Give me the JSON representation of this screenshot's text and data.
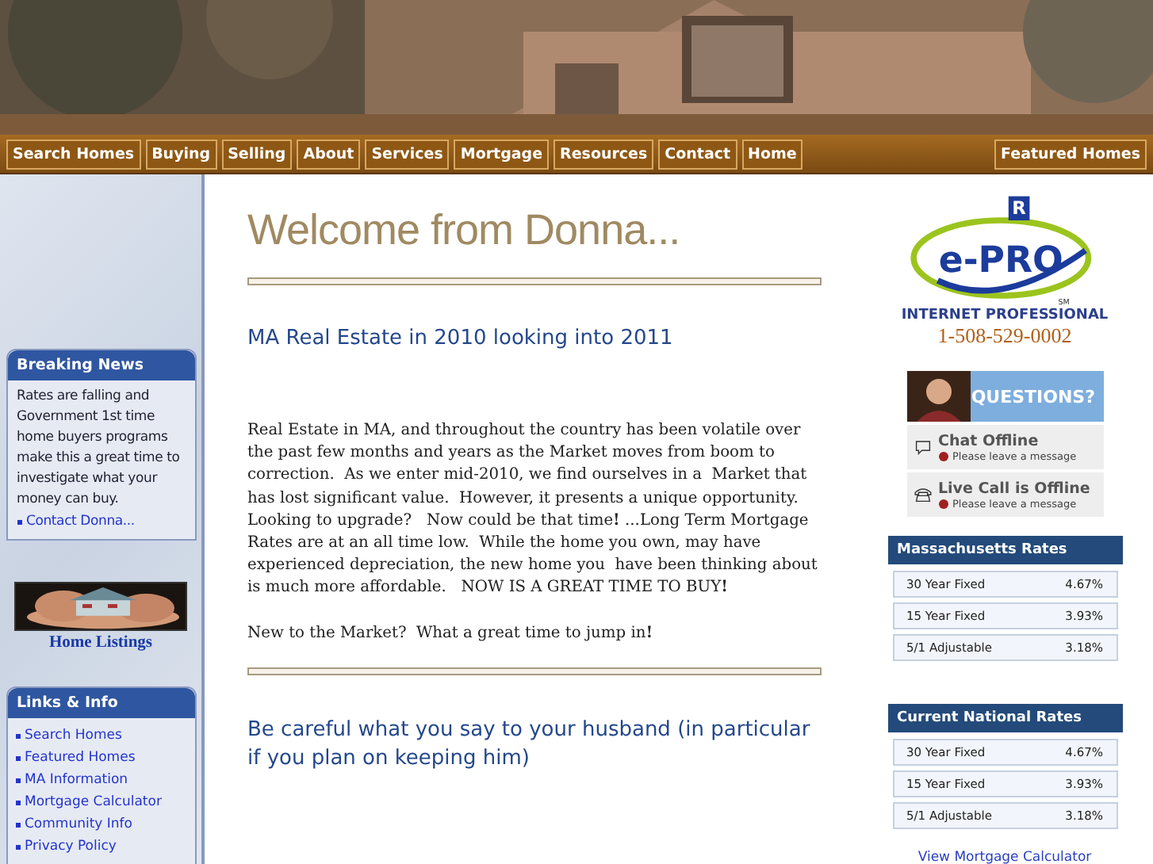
{
  "nav": {
    "items": [
      {
        "label": "Search Homes"
      },
      {
        "label": "Buying"
      },
      {
        "label": "Selling"
      },
      {
        "label": "About"
      },
      {
        "label": "Services"
      },
      {
        "label": "Mortgage"
      },
      {
        "label": "Resources"
      },
      {
        "label": "Contact"
      },
      {
        "label": "Home"
      }
    ],
    "right_item": {
      "label": "Featured Homes"
    }
  },
  "sidebar": {
    "breaking_news": {
      "title": "Breaking News",
      "text": "Rates are falling and Government 1st time home buyers programs make this a great time to investigate what your money can buy.",
      "link": "Contact Donna..."
    },
    "home_listings": {
      "caption": "Home Listings"
    },
    "links": {
      "title": "Links & Info",
      "items": [
        "Search Homes",
        "Featured Homes",
        "MA Information",
        "Mortgage Calculator",
        "Community Info",
        "Privacy Policy"
      ]
    }
  },
  "main": {
    "title": "Welcome from Donna...",
    "heading": "MA Real Estate in 2010 looking into 2011",
    "paragraphs": [
      "Real Estate in MA, and throughout the country has been volatile over the past few months and years as the Market moves from boom to correction.  As we enter mid-2010, we find ourselves in a  Market that has lost significant value.  However, it presents a unique opportunity.  Looking to upgrade?   Now could be that time**!** ...Long Term Mortgage Rates are at an all time low.  While the home you own, may have experienced depreciation, the new home you  have been thinking about is much more affordable.   NOW IS A GREAT TIME TO BUY**!**",
      "New to the Market?  What a great time to jump in**!**"
    ],
    "heading2": "Be careful what you say to your husband (in particular if you plan on keeping him)"
  },
  "right": {
    "logo": {
      "mark": "R",
      "name": "e-PRO",
      "sm": "SM",
      "subtitle": "INTERNET PROFESSIONAL"
    },
    "phone": "1-508-529-0002",
    "questions": {
      "banner": "QUESTIONS?",
      "rows": [
        {
          "kind": "chat",
          "title": "Chat Offline",
          "note": "Please leave a message"
        },
        {
          "kind": "phone",
          "title": "Live Call is Offline",
          "note": "Please leave a message"
        }
      ]
    },
    "rate_tables": [
      {
        "title": "Massachusetts Rates",
        "rows": [
          {
            "name": "30 Year Fixed",
            "rate": "4.67%"
          },
          {
            "name": "15 Year Fixed",
            "rate": "3.93%"
          },
          {
            "name": "5/1 Adjustable",
            "rate": "3.18%"
          }
        ]
      },
      {
        "title": "Current National Rates",
        "rows": [
          {
            "name": "30 Year Fixed",
            "rate": "4.67%"
          },
          {
            "name": "15 Year Fixed",
            "rate": "3.93%"
          },
          {
            "name": "5/1 Adjustable",
            "rate": "3.18%"
          }
        ]
      }
    ],
    "calculator_link": "View Mortgage Calculator"
  }
}
